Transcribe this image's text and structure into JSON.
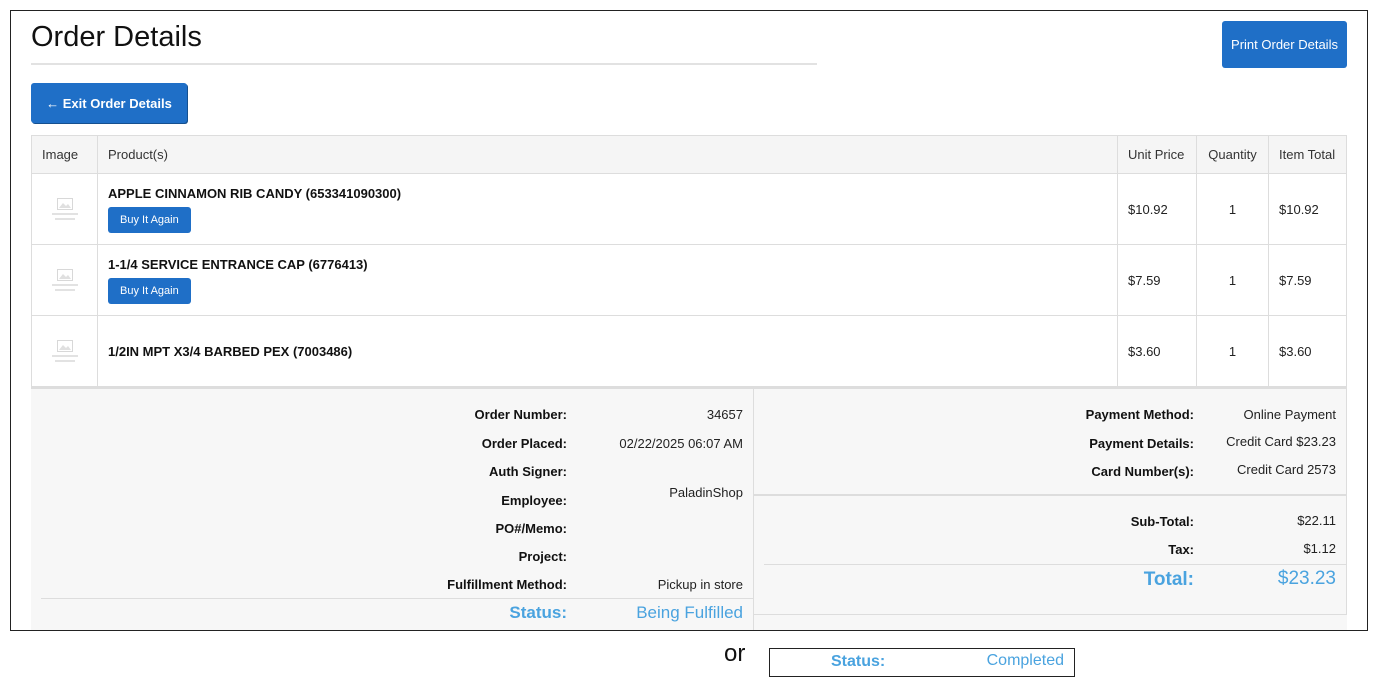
{
  "page": {
    "title": "Order Details",
    "print_label": "Print Order Details",
    "exit_label": "← Exit Order Details"
  },
  "table": {
    "headers": [
      "Image",
      "Product(s)",
      "Unit Price",
      "Quantity",
      "Item Total"
    ],
    "rows": [
      {
        "name": "APPLE CINNAMON RIB CANDY (653341090300)",
        "buy_label": "Buy It Again",
        "unit_price": "$10.92",
        "quantity": "1",
        "item_total": "$10.92"
      },
      {
        "name": "1-1/4 SERVICE ENTRANCE CAP (6776413)",
        "buy_label": "Buy It Again",
        "unit_price": "$7.59",
        "quantity": "1",
        "item_total": "$7.59"
      },
      {
        "name": "1/2IN MPT X3/4 BARBED PEX (7003486)",
        "buy_label": "",
        "unit_price": "$3.60",
        "quantity": "1",
        "item_total": "$3.60"
      }
    ]
  },
  "order_info": {
    "order_number_label": "Order Number:",
    "order_number": "34657",
    "order_placed_label": "Order Placed:",
    "order_placed": "02/22/2025 06:07 AM",
    "auth_signer_label": "Auth Signer:",
    "auth_signer": "",
    "employee_label": "Employee:",
    "employee": "PaladinShop",
    "po_memo_label": "PO#/Memo:",
    "po_memo": "",
    "project_label": "Project:",
    "project": "",
    "fulfillment_label": "Fulfillment Method:",
    "fulfillment": "Pickup in store",
    "status_label": "Status:",
    "status": "Being Fulfilled"
  },
  "payment": {
    "method_label": "Payment Method:",
    "method": "Online Payment",
    "details_label": "Payment Details:",
    "details": "Credit Card $23.23",
    "card_label": "Card Number(s):",
    "card": "Credit Card 2573"
  },
  "totals": {
    "subtotal_label": "Sub-Total:",
    "subtotal": "$22.11",
    "tax_label": "Tax:",
    "tax": "$1.12",
    "total_label": "Total:",
    "total": "$23.23"
  },
  "alternate": {
    "or_text": "or",
    "status_label": "Status:",
    "status": "Completed"
  },
  "colors": {
    "primary_button": "#1f6fc7",
    "status_accent": "#4aa3df"
  },
  "icons": {
    "product_placeholder": "image-placeholder-icon"
  }
}
